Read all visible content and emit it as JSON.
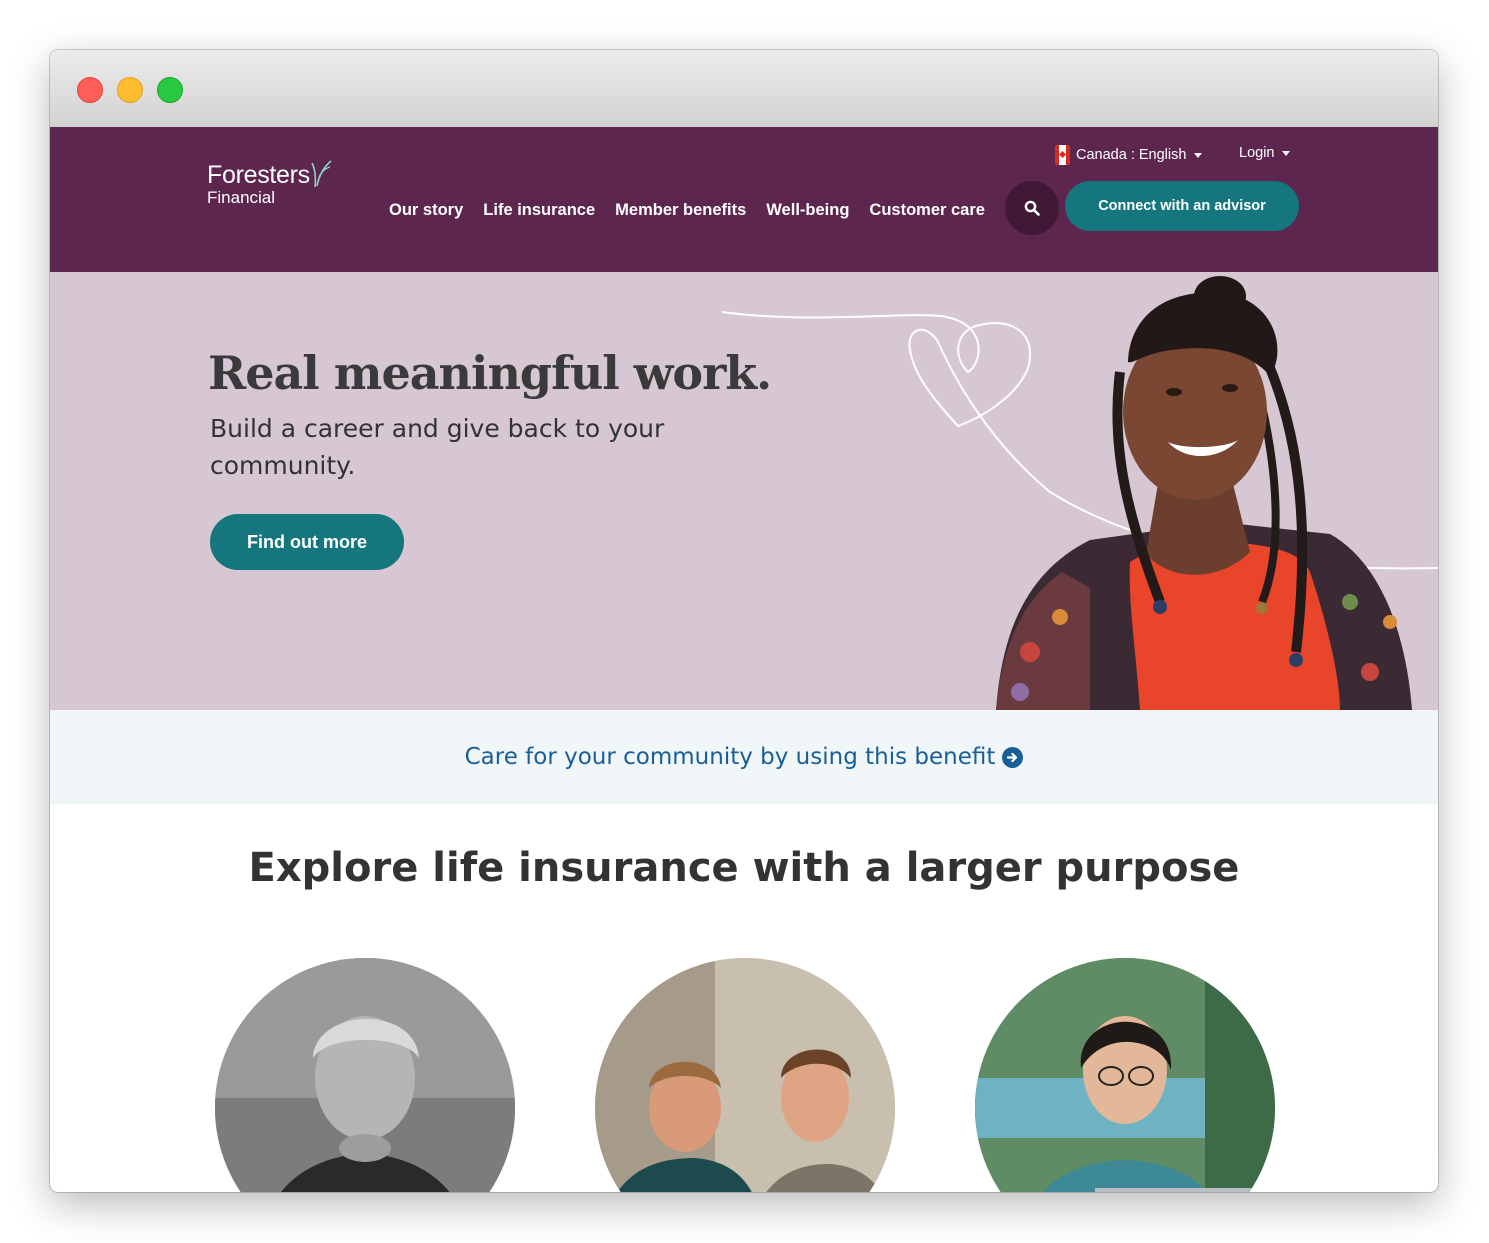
{
  "brand": {
    "line1": "Foresters",
    "line2": "Financial"
  },
  "topbar": {
    "locale": "Canada : English",
    "login": "Login"
  },
  "nav": [
    "Our story",
    "Life insurance",
    "Member benefits",
    "Well-being",
    "Customer care"
  ],
  "header_cta": "Connect with an advisor",
  "hero": {
    "title": "Real meaningful work.",
    "subtitle": "Build a career and give back to your community.",
    "button": "Find out more"
  },
  "benefit_link": "Care for your community by using this benefit",
  "section_title": "Explore life insurance with a larger purpose",
  "colors": {
    "header_bg": "#5c264e",
    "hero_bg": "#d6c7d2",
    "accent_teal": "#15777d",
    "link_blue": "#1a5e96",
    "band_bg": "#f1f6f9"
  },
  "icons": [
    "canada-flag-icon",
    "caret-down-icon",
    "search-icon",
    "arrow-circle-right-icon"
  ]
}
